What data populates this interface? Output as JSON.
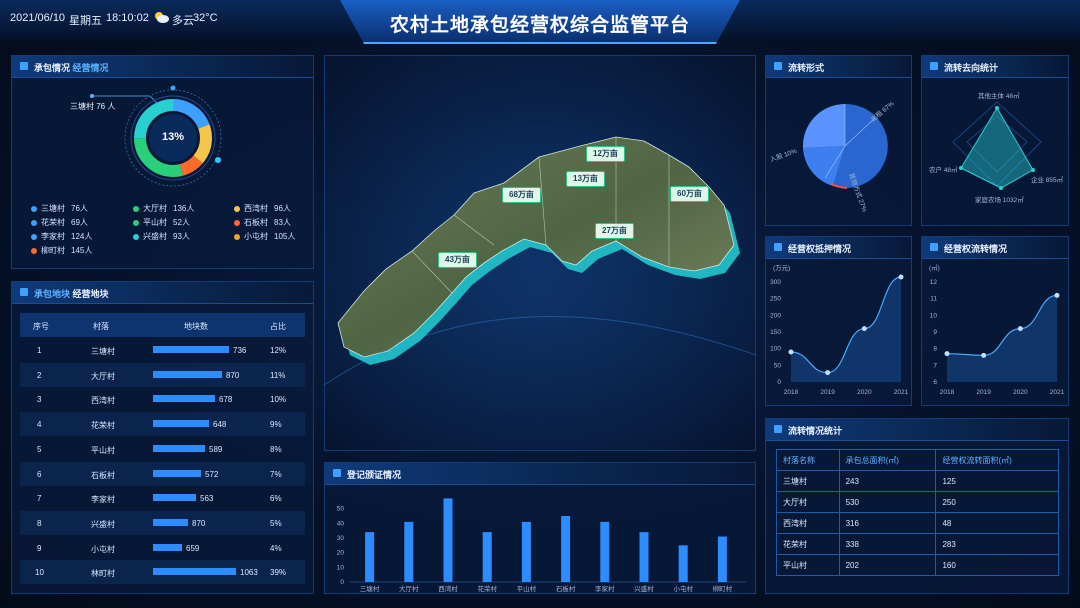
{
  "header": {
    "date": "2021/06/10",
    "weekday": "星期五",
    "time": "18:10:02",
    "weather": "多云",
    "temp": "32°C",
    "title": "农村土地承包经营权综合监管平台"
  },
  "contract": {
    "title_a": "承包情况",
    "title_b": "经营情况",
    "callout": "三塘村 76 人",
    "center": "13%",
    "legend": [
      {
        "name": "三塘村",
        "value": "76人",
        "color": "#3ea0ff"
      },
      {
        "name": "大厅村",
        "value": "136人",
        "color": "#28d07a"
      },
      {
        "name": "西湾村",
        "value": "96人",
        "color": "#f5c64a"
      },
      {
        "name": "花荣村",
        "value": "69人",
        "color": "#3ea0ff"
      },
      {
        "name": "平山村",
        "value": "52人",
        "color": "#28d07a"
      },
      {
        "name": "石板村",
        "value": "83人",
        "color": "#ff6a2a"
      },
      {
        "name": "李家村",
        "value": "124人",
        "color": "#3ea0ff"
      },
      {
        "name": "兴盛村",
        "value": "93人",
        "color": "#28d0d0"
      },
      {
        "name": "小屯村",
        "value": "105人",
        "color": "#f5a42a"
      },
      {
        "name": "柳町村",
        "value": "145人",
        "color": "#ff6a2a"
      }
    ]
  },
  "plots": {
    "title_a": "承包地块",
    "title_b": "经营地块",
    "headers": [
      "序号",
      "村落",
      "地块数",
      "占比"
    ],
    "rows": [
      {
        "no": "1",
        "village": "三塘村",
        "count": "736",
        "pct": "12%",
        "ratio": 0.69
      },
      {
        "no": "2",
        "village": "大厅村",
        "count": "870",
        "pct": "11%",
        "ratio": 0.63
      },
      {
        "no": "3",
        "village": "西湾村",
        "count": "678",
        "pct": "10%",
        "ratio": 0.56
      },
      {
        "no": "4",
        "village": "花荣村",
        "count": "648",
        "pct": "9%",
        "ratio": 0.51
      },
      {
        "no": "5",
        "village": "平山村",
        "count": "589",
        "pct": "8%",
        "ratio": 0.47
      },
      {
        "no": "6",
        "village": "石板村",
        "count": "572",
        "pct": "7%",
        "ratio": 0.44
      },
      {
        "no": "7",
        "village": "李家村",
        "count": "563",
        "pct": "6%",
        "ratio": 0.39
      },
      {
        "no": "8",
        "village": "兴盛村",
        "count": "870",
        "pct": "5%",
        "ratio": 0.32
      },
      {
        "no": "9",
        "village": "小屯村",
        "count": "659",
        "pct": "4%",
        "ratio": 0.26
      },
      {
        "no": "10",
        "village": "林町村",
        "count": "1063",
        "pct": "39%",
        "ratio": 0.75
      }
    ]
  },
  "map": {
    "tags": [
      "12万亩",
      "13万亩",
      "68万亩",
      "60万亩",
      "27万亩",
      "43万亩"
    ]
  },
  "registration": {
    "title": "登记颁证情况",
    "chart_data": {
      "type": "bar",
      "categories": [
        "三塘村",
        "大厅村",
        "西湾村",
        "花荣村",
        "平山村",
        "石板村",
        "李家村",
        "兴盛村",
        "小屯村",
        "柳町村"
      ],
      "values": [
        34,
        41,
        57,
        34,
        41,
        45,
        41,
        34,
        25,
        31
      ],
      "ylim": [
        0,
        60
      ],
      "yticks": [
        "0",
        "10",
        "20",
        "30",
        "40",
        "50"
      ]
    }
  },
  "flow_form": {
    "title": "流转形式",
    "chart_data": {
      "type": "pie",
      "labels": [
        "出租 67%",
        "入股 10%",
        "其他方式 27%"
      ]
    }
  },
  "flow_dest": {
    "title": "流转去向统计",
    "chart_data": {
      "type": "radar",
      "labels": [
        "其他主体 48㎡",
        "企业 855㎡",
        "家庭农场 1032㎡",
        "农户 48㎡"
      ],
      "values": [
        0.55,
        0.75,
        0.85,
        0.5
      ]
    }
  },
  "mortgage": {
    "title": "经营权抵押情况",
    "unit": "(万元)",
    "chart_data": {
      "type": "line",
      "x": [
        "2018",
        "2019",
        "2020",
        "2021"
      ],
      "values": [
        90,
        28,
        160,
        315
      ],
      "ylim": [
        0,
        300
      ],
      "yticks": [
        "0",
        "50",
        "100",
        "150",
        "200",
        "250",
        "300"
      ]
    }
  },
  "transfer": {
    "title": "经营权流转情况",
    "unit": "(㎡)",
    "chart_data": {
      "type": "line",
      "x": [
        "2018",
        "2019",
        "2020",
        "2021"
      ],
      "values": [
        7.7,
        7.6,
        9.2,
        11.2
      ],
      "ylim": [
        6,
        12
      ],
      "yticks": [
        "6",
        "7",
        "8",
        "9",
        "10",
        "11",
        "12"
      ]
    }
  },
  "flow_stats": {
    "title": "流转情况统计",
    "headers": [
      "村落名称",
      "承包总面积(㎡)",
      "经营权流转面积(㎡)"
    ],
    "rows": [
      [
        "三塘村",
        "243",
        "125"
      ],
      [
        "大厅村",
        "530",
        "250"
      ],
      [
        "西湾村",
        "316",
        "48"
      ],
      [
        "花荣村",
        "338",
        "283"
      ],
      [
        "平山村",
        "202",
        "160"
      ]
    ]
  }
}
